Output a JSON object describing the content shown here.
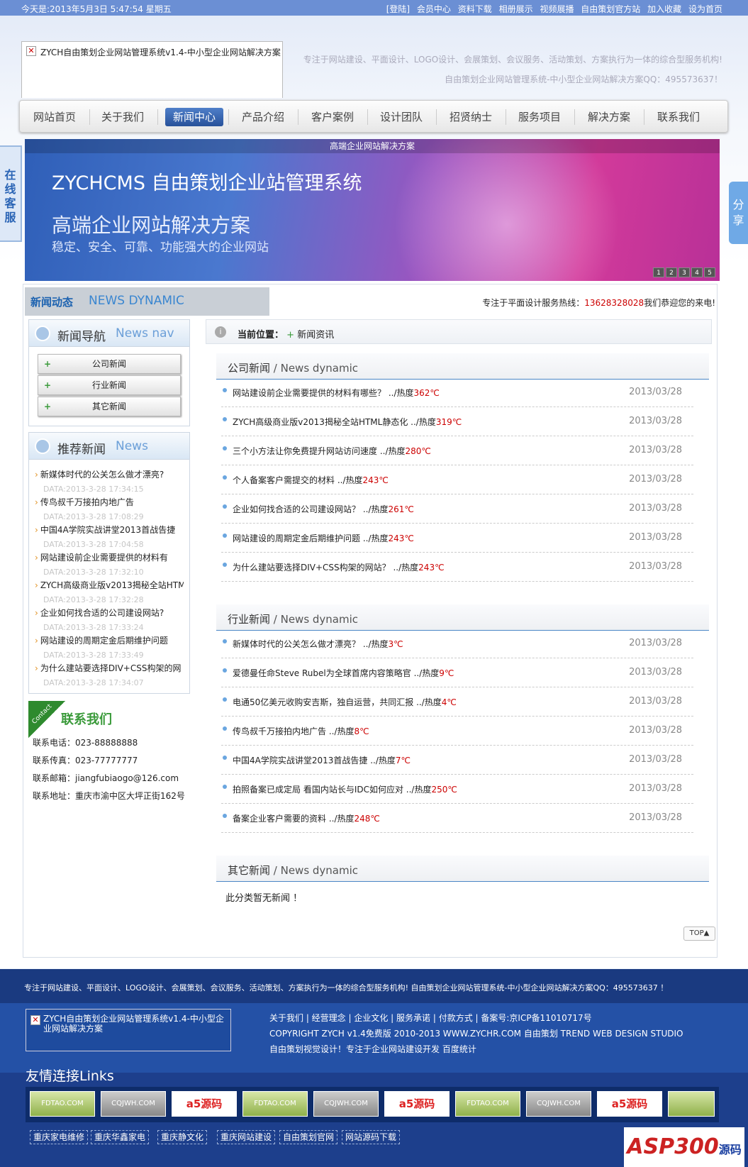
{
  "topbar": {
    "date_text": "今天是:2013年5月3日 5:47:54 星期五",
    "links": [
      "[登陆]",
      "会员中心",
      "资料下载",
      "相册展示",
      "视频展播",
      "自由策划官方站",
      "加入收藏",
      "设为首页"
    ]
  },
  "header": {
    "logo_alt": "ZYCH自由策划企业网站管理系统v1.4-中小型企业网站解决方案",
    "slogan1": "专注于网站建设、平面设计、LOGO设计、会展策划、会议服务、活动策划、方案执行为一体的综合型服务机构!",
    "slogan2": "自由策划企业网站管理系统-中小型企业网站解决方案QQ：495573637！"
  },
  "nav": {
    "items": [
      "网站首页",
      "关于我们",
      "新闻中心",
      "产品介绍",
      "客户案例",
      "设计团队",
      "招贤纳士",
      "服务项目",
      "解决方案",
      "联系我们"
    ],
    "active_index": 2
  },
  "side_tabs": {
    "left": "在线客服",
    "right": "分享"
  },
  "banner": {
    "caption": "高端企业网站解决方案",
    "title": "ZYCHCMS 自由策划企业站管理系统",
    "subtitle": "高端企业网站解决方案",
    "tagline": "稳定、安全、可靠、功能强大的企业网站",
    "pages": [
      "1",
      "2",
      "3",
      "4",
      "5"
    ]
  },
  "section": {
    "cn": "新闻动态",
    "en": "NEWS DYNAMIC",
    "hotline_label": "专注于平面设计服务热线：",
    "hotline_number": "13628328028",
    "hotline_tail": "我们恭迎您的来电!"
  },
  "news_nav": {
    "cn": "新闻导航",
    "en": "News nav",
    "items": [
      "公司新闻",
      "行业新闻",
      "其它新闻"
    ]
  },
  "recommended": {
    "cn": "推荐新闻",
    "en": "News",
    "items": [
      {
        "title": "新媒体时代的公关怎么做才漂亮?",
        "date": "DATA:2013-3-28 17:34:15"
      },
      {
        "title": "传鸟叔千万接拍内地广告",
        "date": "DATA:2013-3-28 17:08:29"
      },
      {
        "title": "中国4A学院实战讲堂2013首战告捷",
        "date": "DATA:2013-3-28 17:04:58"
      },
      {
        "title": "网站建设前企业需要提供的材料有",
        "date": "DATA:2013-3-28 17:32:10"
      },
      {
        "title": "ZYCH高级商业版v2013揭秘全站HTM",
        "date": "DATA:2013-3-28 17:32:28"
      },
      {
        "title": "企业如何找合适的公司建设网站?",
        "date": "DATA:2013-3-28 17:33:24"
      },
      {
        "title": "网站建设的周期定金后期维护问题",
        "date": "DATA:2013-3-28 17:33:49"
      },
      {
        "title": "为什么建站要选择DIV+CSS构架的网",
        "date": "DATA:2013-3-28 17:34:07"
      }
    ]
  },
  "contact": {
    "ribbon": "Contact",
    "title": "联系我们",
    "phone": "联系电话：023-88888888",
    "fax": "联系传真：023-77777777",
    "email": "联系邮箱：jiangfubiaogo@126.com",
    "address": "联系地址：重庆市渝中区大坪正街162号"
  },
  "breadcrumb": {
    "label": "当前位置：",
    "current": "新闻资讯"
  },
  "categories": [
    {
      "cn": "公司新闻",
      "en": " / News dynamic",
      "items": [
        {
          "title": "网站建设前企业需要提供的材料有哪些？",
          "heat_label": " ../热度",
          "heat": "362℃",
          "date": "2013/03/28"
        },
        {
          "title": "ZYCH高级商业版v2013揭秘全站HTML静态化",
          "heat_label": " ../热度",
          "heat": "319℃",
          "date": "2013/03/28"
        },
        {
          "title": "三个小方法让你免费提升网站访问速度",
          "heat_label": " ../热度",
          "heat": "280℃",
          "date": "2013/03/28"
        },
        {
          "title": "个人备案客户需提交的材料",
          "heat_label": " ../热度",
          "heat": "243℃",
          "date": "2013/03/28"
        },
        {
          "title": "企业如何找合适的公司建设网站？",
          "heat_label": " ../热度",
          "heat": "261℃",
          "date": "2013/03/28"
        },
        {
          "title": "网站建设的周期定金后期维护问题",
          "heat_label": " ../热度",
          "heat": "243℃",
          "date": "2013/03/28"
        },
        {
          "title": "为什么建站要选择DIV+CSS构架的网站？",
          "heat_label": " ../热度",
          "heat": "243℃",
          "date": "2013/03/28"
        }
      ]
    },
    {
      "cn": "行业新闻",
      "en": " / News dynamic",
      "items": [
        {
          "title": "新媒体时代的公关怎么做才漂亮？",
          "heat_label": " ../热度",
          "heat": "3℃",
          "date": "2013/03/28"
        },
        {
          "title": "爱德曼任命Steve Rubel为全球首席内容策略官",
          "heat_label": " ../热度",
          "heat": "9℃",
          "date": "2013/03/28"
        },
        {
          "title": "电通50亿美元收购安吉斯，独自运营，共同汇报",
          "heat_label": " ../热度",
          "heat": "4℃",
          "date": "2013/03/28"
        },
        {
          "title": "传鸟叔千万接拍内地广告",
          "heat_label": " ../热度",
          "heat": "8℃",
          "date": "2013/03/28"
        },
        {
          "title": "中国4A学院实战讲堂2013首战告捷",
          "heat_label": " ../热度",
          "heat": "7℃",
          "date": "2013/03/28"
        },
        {
          "title": "拍照备案已成定局 看国内站长与IDC如何应对",
          "heat_label": " ../热度",
          "heat": "250℃",
          "date": "2013/03/28"
        },
        {
          "title": "备案企业客户需要的资料",
          "heat_label": " ../热度",
          "heat": "248℃",
          "date": "2013/03/28"
        }
      ]
    },
    {
      "cn": "其它新闻",
      "en": " / News dynamic",
      "items": []
    }
  ],
  "empty_note": "此分类暂无新闻 ！",
  "top_button": "TOP▲",
  "footer": {
    "strip": "专注于网站建设、平面设计、LOGO设计、会展策划、会议服务、活动策划、方案执行为一体的综合型服务机构! 自由策划企业网站管理系统-中小型企业网站解决方案QQ：495573637 ！",
    "logo_alt": "ZYCH自由策划企业网站管理系统v1.4-中小型企业网站解决方案",
    "line1": "关于我们 | 经营理念 | 企业文化 | 服务承诺 | 付款方式 | 备案号:京ICP备11010717号",
    "line2": "COPYRIGHT ZYCH v1.4免费版  2010-2013 WWW.ZYCHR.COM 自由策划  TREND WEB DESIGN STUDIO",
    "line3": "自由策划视觉设计！专注于企业网站建设开发 百度统计",
    "links_title": "友情连接Links",
    "link_images": [
      "FDTAO.COM",
      "CQJWH.COM",
      "a5源码",
      "FDTAO.COM",
      "CQJWH.COM",
      "a5源码",
      "FDTAO.COM",
      "CQJWH.COM",
      "a5源码"
    ],
    "text_links": [
      "重庆家电维修",
      "重庆华鑫家电",
      "重庆静文化",
      "重庆网站建设",
      "自由策划官网",
      "网站源码下载"
    ],
    "corner_logo": "ASP300",
    "corner_logo_tail": "源码"
  }
}
